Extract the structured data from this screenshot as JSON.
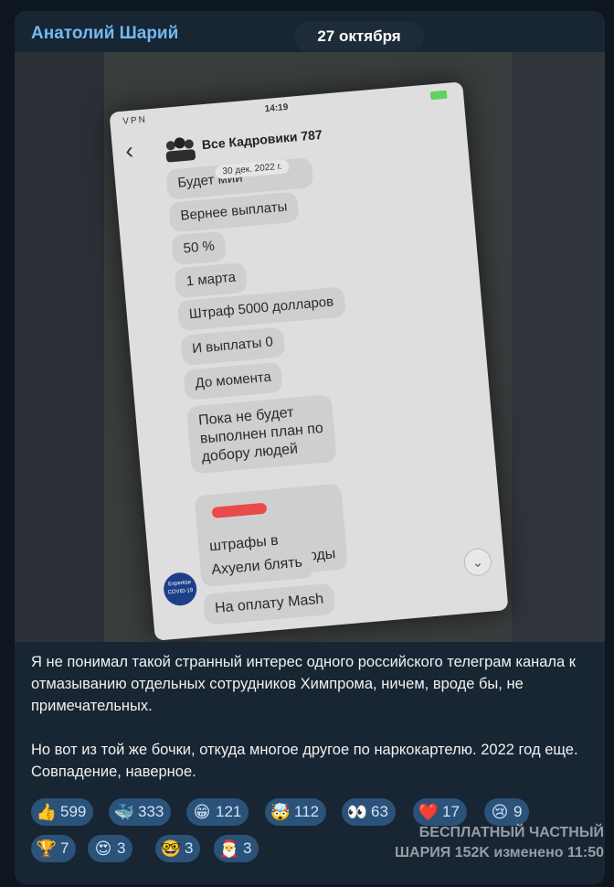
{
  "message": {
    "author": "Анатолий Шарий",
    "date": "27 октября",
    "text": "Я не понимал такой странный интерес одного российского телеграм канала  к отмазыванию отдельных сотрудников Химпрома, ничем, вроде бы, не примечательных.\n\nНо вот из той же бочки, откуда многое другое по наркокартелю. 2022 год еще. Совпадение, наверное."
  },
  "photo": {
    "status_time": "14:19",
    "status_left": "VPN",
    "chat_title": "Все Кадровики 787",
    "date_chip": "30 дек. 2022 г.",
    "bubbles": [
      "Будет         мии",
      "Вернее выплаты",
      "50 %",
      "1 марта",
      "Штраф 5000 долларов",
      "И выплаты 0",
      "До момента",
      "Пока не будет\nвыполнен план по\nдобору людей",
      "         штрафы в\nобщак на расходы",
      "Ахуели блять",
      "На оплату Mash"
    ],
    "badge_text": "Expertise COVID-19"
  },
  "reactions": [
    {
      "emoji": "👍",
      "icon": "thumbs-up-icon",
      "count": "599"
    },
    {
      "emoji": "🐳",
      "icon": "whale-icon",
      "count": "333"
    },
    {
      "emoji": "😁",
      "icon": "grin-icon",
      "count": "121"
    },
    {
      "emoji": "🤯",
      "icon": "mind-blown-icon",
      "count": "112"
    },
    {
      "emoji": "👀",
      "icon": "eyes-icon",
      "count": "63"
    },
    {
      "emoji": "❤️",
      "icon": "heart-icon",
      "count": "17"
    },
    {
      "emoji": "😢",
      "icon": "crying-icon",
      "count": "9"
    },
    {
      "emoji": "🏆",
      "icon": "trophy-icon",
      "count": "7"
    },
    {
      "emoji": "😍",
      "icon": "heart-eyes-icon",
      "count": "3"
    },
    {
      "emoji": "🤓",
      "icon": "nerd-icon",
      "count": "3"
    },
    {
      "emoji": "🎅",
      "icon": "santa-icon",
      "count": "3"
    }
  ],
  "watermark": {
    "line1": "БЕСПЛАТНЫЙ ЧАСТНЫЙ",
    "line2": "ШАРИЯ 152K изменено 11:50"
  },
  "colors": {
    "background": "#0e1621",
    "bubble": "#182533",
    "author": "#71baf5",
    "reaction": "#2b5278"
  }
}
